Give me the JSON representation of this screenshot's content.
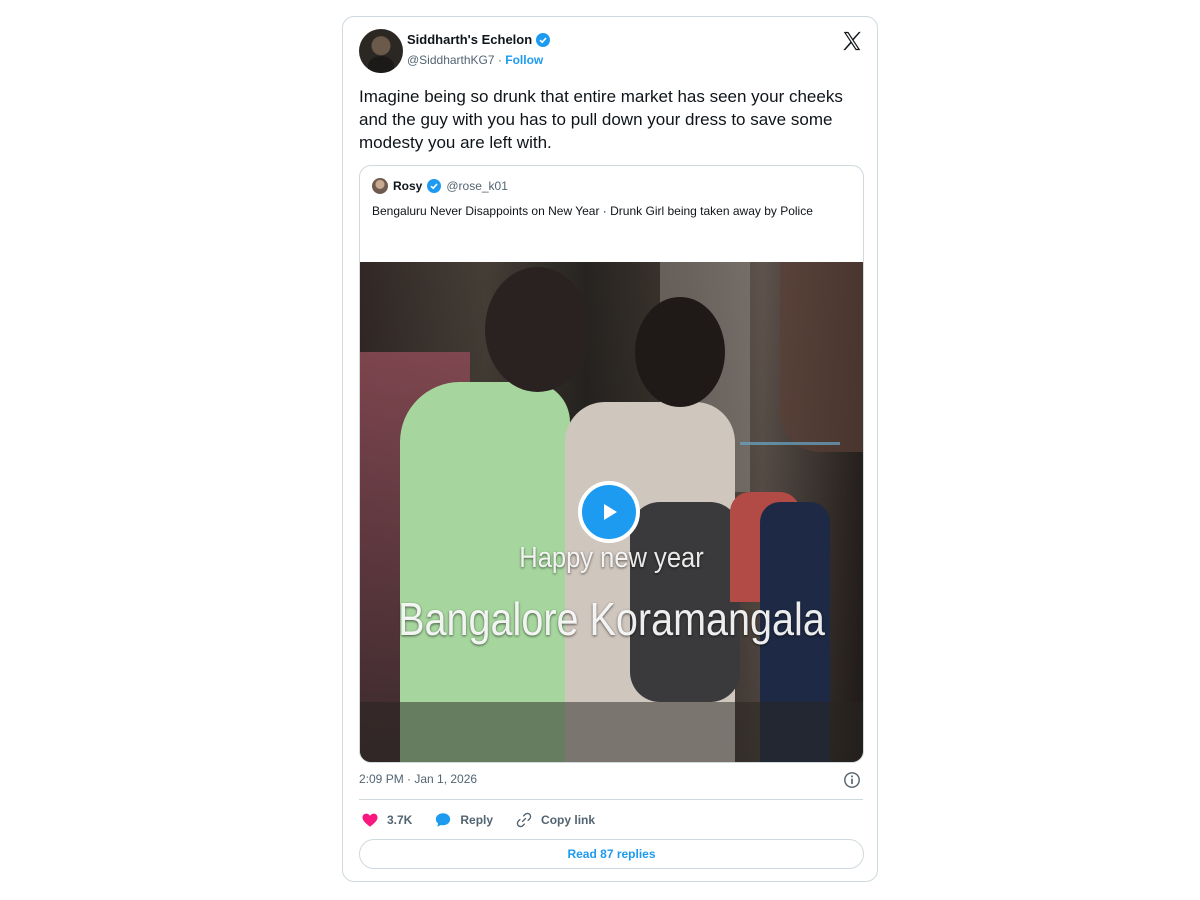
{
  "tweet": {
    "author_name": "Siddharth's Echelon",
    "handle": "@SiddharthKG7",
    "separator": "·",
    "follow_label": "Follow",
    "text": "Imagine being so drunk that entire market has seen your cheeks and the guy with you has to pull down your dress to save some modesty you are left with.",
    "timestamp": "2:09 PM · Jan 1, 2026"
  },
  "quoted": {
    "author_name": "Rosy",
    "handle": "@rose_k01",
    "text": "Bengaluru Never Disappoints on New Year · Drunk Girl being taken away by Police",
    "video_caption_line1": "Happy new year",
    "video_caption_line2": "Bangalore Koramangala"
  },
  "actions": {
    "like_count": "3.7K",
    "reply_label": "Reply",
    "copy_label": "Copy link",
    "read_replies_label": "Read 87 replies"
  },
  "icons": [
    "x-logo-icon",
    "verified-badge-icon",
    "play-icon",
    "info-icon",
    "heart-icon",
    "reply-bubble-icon",
    "link-icon"
  ],
  "colors": {
    "accent": "#1d9bf0",
    "like": "#f91880",
    "text": "#0f1419",
    "muted": "#536471",
    "border": "#cfd9de"
  }
}
